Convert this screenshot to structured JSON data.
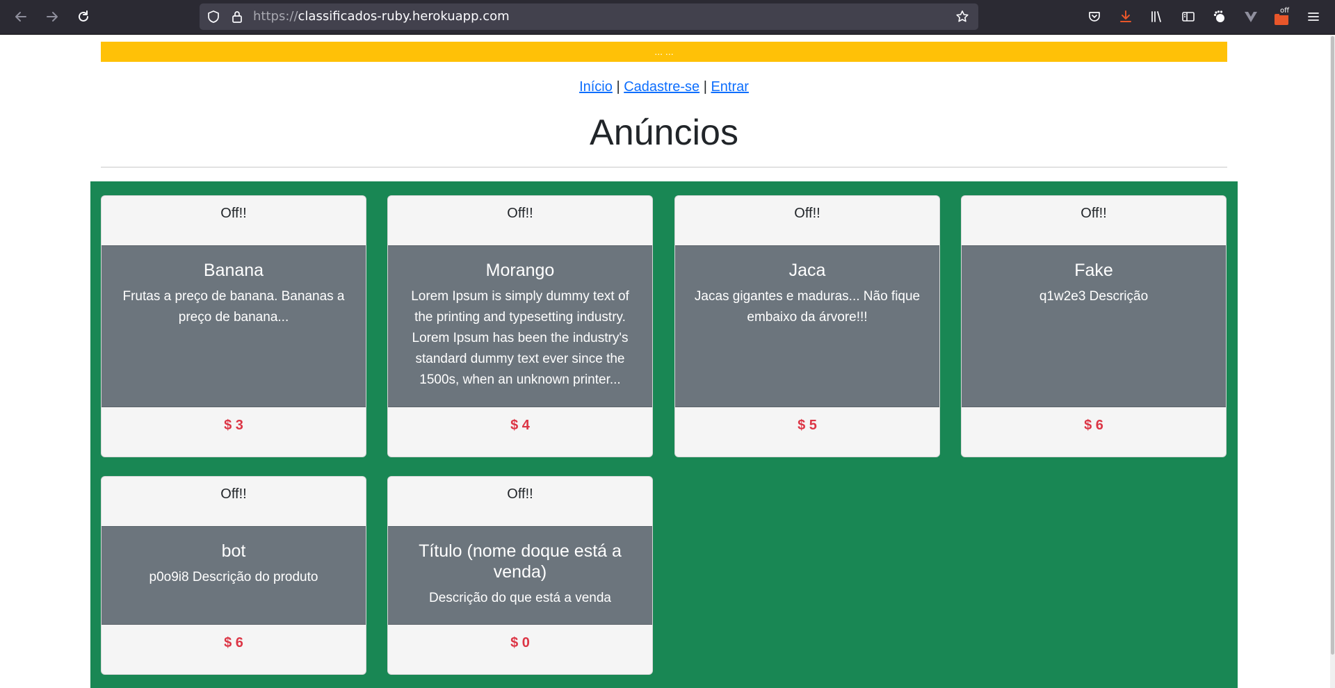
{
  "browser": {
    "url_scheme": "https://",
    "url_host": "classificados-ruby.herokuapp.com",
    "extension_badge": "off"
  },
  "notice": "... ...",
  "nav": {
    "home": "Início",
    "separator": "|",
    "signup": "Cadastre-se",
    "login": "Entrar"
  },
  "page_title": "Anúncios",
  "listings": [
    {
      "badge": "Off!!",
      "title": "Banana",
      "description": "Frutas a preço de banana. Bananas a preço de banana...",
      "price": "$ 3"
    },
    {
      "badge": "Off!!",
      "title": "Morango",
      "description": "Lorem Ipsum is simply dummy text of the printing and typesetting industry. Lorem Ipsum has been the industry's standard dummy text ever since the 1500s, when an unknown printer...",
      "price": "$ 4"
    },
    {
      "badge": "Off!!",
      "title": "Jaca",
      "description": "Jacas gigantes e maduras... Não fique embaixo da árvore!!!",
      "price": "$ 5"
    },
    {
      "badge": "Off!!",
      "title": "Fake",
      "description": "q1w2e3 Descrição",
      "price": "$ 6"
    },
    {
      "badge": "Off!!",
      "title": "bot",
      "description": "p0o9i8 Descrição do produto",
      "price": "$ 6"
    },
    {
      "badge": "Off!!",
      "title": "Título (nome doque está a venda)",
      "description": "Descrição do que está a venda",
      "price": "$ 0"
    }
  ],
  "colors": {
    "notice_bg": "#ffc107",
    "listing_area_bg": "#198754",
    "card_body_bg": "#6c757d",
    "price": "#dc3545",
    "link": "#0d6efd"
  }
}
